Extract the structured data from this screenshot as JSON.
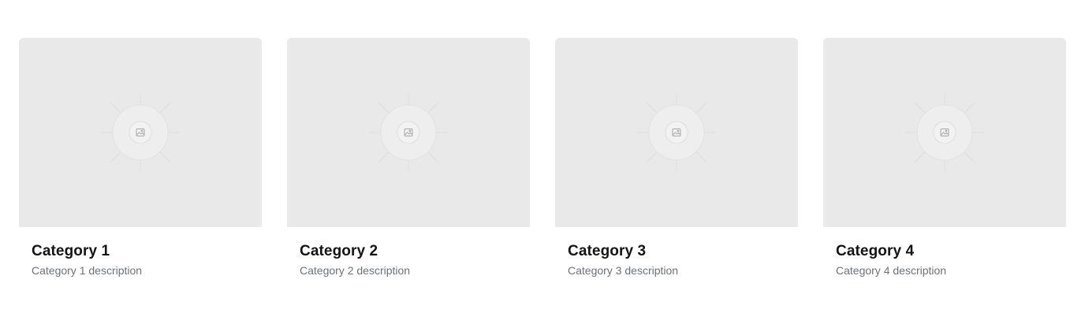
{
  "categories": [
    {
      "title": "Category 1",
      "description": "Category 1 description",
      "image_icon": "image-placeholder-icon"
    },
    {
      "title": "Category 2",
      "description": "Category 2 description",
      "image_icon": "image-placeholder-icon"
    },
    {
      "title": "Category 3",
      "description": "Category 3 description",
      "image_icon": "image-placeholder-icon"
    },
    {
      "title": "Category 4",
      "description": "Category 4 description",
      "image_icon": "image-placeholder-icon"
    }
  ],
  "colors": {
    "thumbnail_bg": "#e9e9e9",
    "title": "#141414",
    "description": "#6e7178"
  }
}
